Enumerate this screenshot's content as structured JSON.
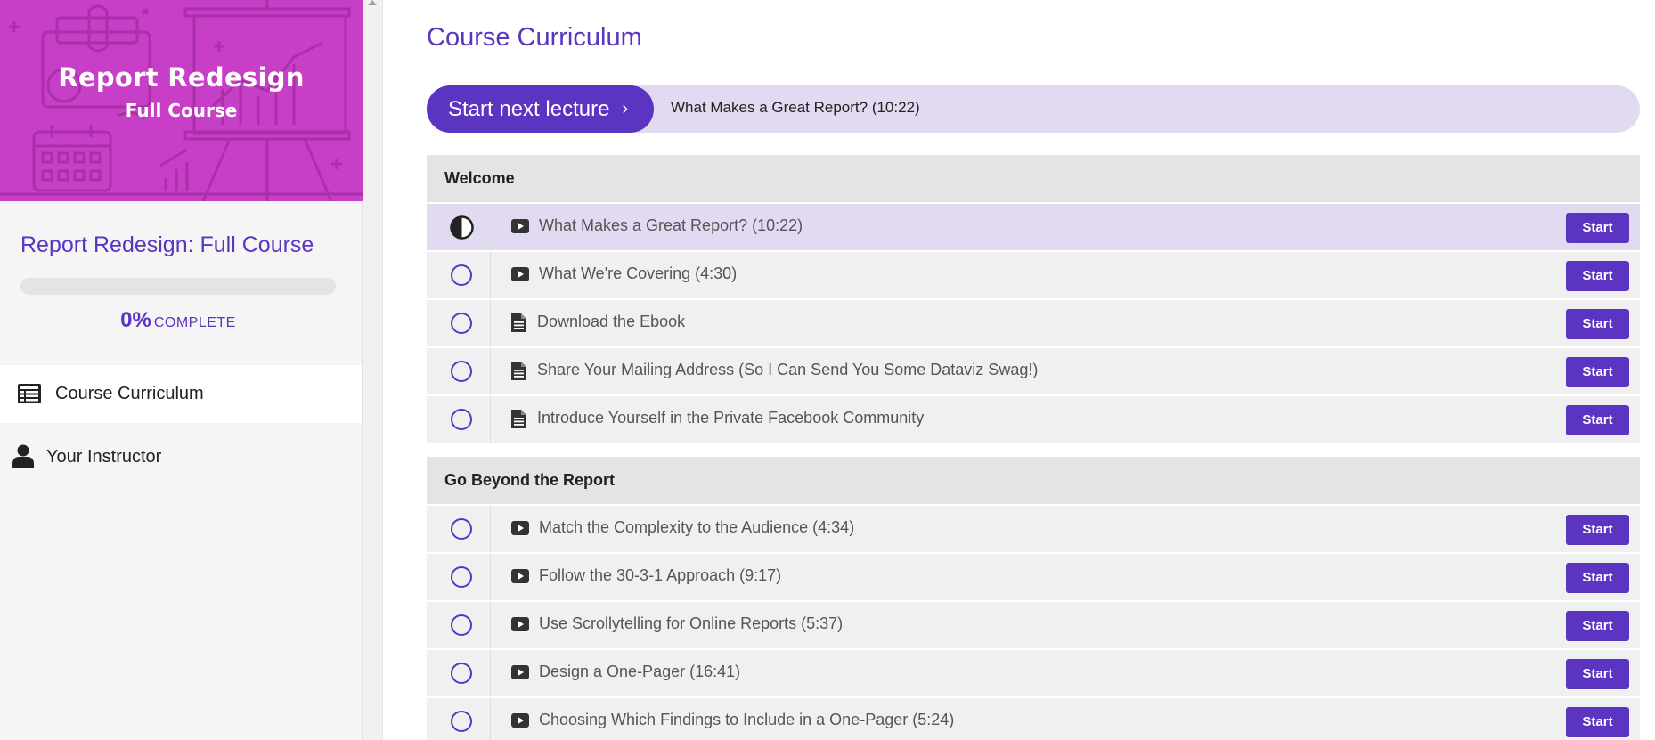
{
  "sidebar": {
    "hero": {
      "title_line1": "Report Redesign",
      "title_line2": "Full Course",
      "background": "#c63fc6"
    },
    "course_title": "Report Redesign: Full Course",
    "progress": {
      "percent": 0,
      "percent_label": "0%",
      "complete_label": "COMPLETE"
    },
    "nav": [
      {
        "label": "Course Curriculum",
        "icon": "curriculum-list-icon",
        "active": true
      },
      {
        "label": "Your Instructor",
        "icon": "user-icon",
        "active": false
      }
    ]
  },
  "main": {
    "title": "Course Curriculum",
    "next_lecture": {
      "button_label": "Start next lecture",
      "button_chevron": "›",
      "lecture_title": "What Makes a Great Report? (10:22)"
    },
    "sections": [
      {
        "title": "Welcome",
        "lessons": [
          {
            "title": "What Makes a Great Report? (10:22)",
            "type": "video",
            "status": "in-progress",
            "button": "Start"
          },
          {
            "title": "What We're Covering (4:30)",
            "type": "video",
            "status": "not-started",
            "button": "Start"
          },
          {
            "title": "Download the Ebook",
            "type": "document",
            "status": "not-started",
            "button": "Start"
          },
          {
            "title": "Share Your Mailing Address (So I Can Send You Some Dataviz Swag!)",
            "type": "document",
            "status": "not-started",
            "button": "Start"
          },
          {
            "title": "Introduce Yourself in the Private Facebook Community",
            "type": "document",
            "status": "not-started",
            "button": "Start"
          }
        ]
      },
      {
        "title": "Go Beyond the Report",
        "lessons": [
          {
            "title": "Match the Complexity to the Audience (4:34)",
            "type": "video",
            "status": "not-started",
            "button": "Start"
          },
          {
            "title": "Follow the 30-3-1 Approach (9:17)",
            "type": "video",
            "status": "not-started",
            "button": "Start"
          },
          {
            "title": "Use Scrollytelling for Online Reports (5:37)",
            "type": "video",
            "status": "not-started",
            "button": "Start"
          },
          {
            "title": "Design a One-Pager (16:41)",
            "type": "video",
            "status": "not-started",
            "button": "Start"
          },
          {
            "title": "Choosing Which Findings to Include in a One-Pager (5:24)",
            "type": "video",
            "status": "not-started",
            "button": "Start"
          }
        ]
      }
    ]
  },
  "colors": {
    "accent": "#5b34c2",
    "current_row": "#e2daf0",
    "row": "#f0f0f0",
    "section_header": "#e4e4e4"
  }
}
